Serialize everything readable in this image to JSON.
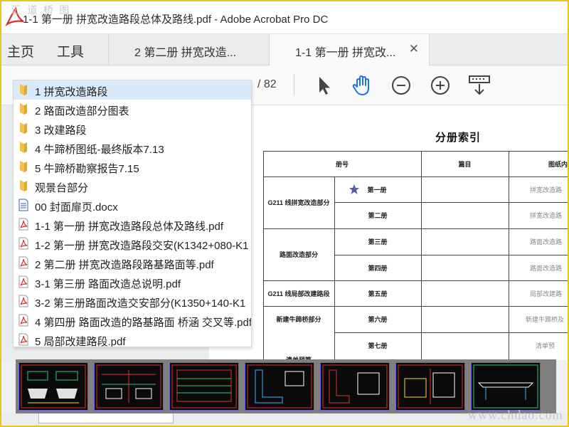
{
  "window": {
    "watermark": "汇 道 桥 图",
    "title": "1-1 第一册 拼宽改造路段总体及路线.pdf - Adobe Acrobat Pro DC"
  },
  "nav": {
    "home": "主页",
    "tools": "工具"
  },
  "tabs": [
    {
      "label": "2 第二册 拼宽改造..."
    },
    {
      "label": "1-1 第一册 拼宽改..."
    }
  ],
  "toolbar": {
    "page_total": "/ 82"
  },
  "dropdown": {
    "items": [
      {
        "label": "1 拼宽改造路段",
        "type": "folder",
        "selected": true
      },
      {
        "label": "2 路面改造部分图表",
        "type": "folder"
      },
      {
        "label": "3 改建路段",
        "type": "folder"
      },
      {
        "label": "4 牛蹄桥图纸-最终版本7.13",
        "type": "folder"
      },
      {
        "label": "5 牛蹄桥勘察报告7.15",
        "type": "folder"
      },
      {
        "label": "观景台部分",
        "type": "folder"
      },
      {
        "label": "00 封面扉页.docx",
        "type": "docx"
      },
      {
        "label": "1-1 第一册 拼宽改造路段总体及路线.pdf",
        "type": "pdf"
      },
      {
        "label": "1-2 第一册 拼宽改造路段交安(K1342+080-K1",
        "type": "pdf"
      },
      {
        "label": "2 第二册 拼宽改造路段路基路面等.pdf",
        "type": "pdf"
      },
      {
        "label": "3-1 第三册 路面改造总说明.pdf",
        "type": "pdf"
      },
      {
        "label": "3-2 第三册路面改造交安部分(K1350+140-K1",
        "type": "pdf"
      },
      {
        "label": "4 第四册 路面改造的路基路面 桥涵 交叉等.pdf",
        "type": "pdf"
      },
      {
        "label": "5 局部改建路段.pdf",
        "type": "pdf"
      }
    ]
  },
  "document": {
    "title": "分册索引",
    "headers": {
      "volume_no": "册号",
      "chapter": "篇目",
      "content": "图纸内"
    },
    "groups": [
      {
        "name": "G211 线拼宽改造部分"
      },
      {
        "name": "路面改造部分"
      },
      {
        "name": "G211 线局部改建路段"
      },
      {
        "name": "新建牛蹄桥部分"
      },
      {
        "name": "清单预算"
      }
    ],
    "rows": [
      {
        "volume": "第一册",
        "content": "拼宽改造路"
      },
      {
        "volume": "第二册",
        "content": "拼宽改造路"
      },
      {
        "volume": "第三册",
        "content": "路面改造路"
      },
      {
        "volume": "第四册",
        "content": "路面改造路"
      },
      {
        "volume": "第五册",
        "content": "局部改建路"
      },
      {
        "volume": "第六册",
        "content": "新建牛蹄桥及"
      },
      {
        "volume": "第七册",
        "content": "清单预"
      }
    ]
  },
  "bottom_watermark": "www.chdao.com",
  "colors": {
    "selected_bg": "#d9ebfb",
    "folder": "#f2c14e",
    "pdf_red": "#d6322c",
    "tool_blue": "#1a73e8",
    "window_border": "#e6c619"
  }
}
